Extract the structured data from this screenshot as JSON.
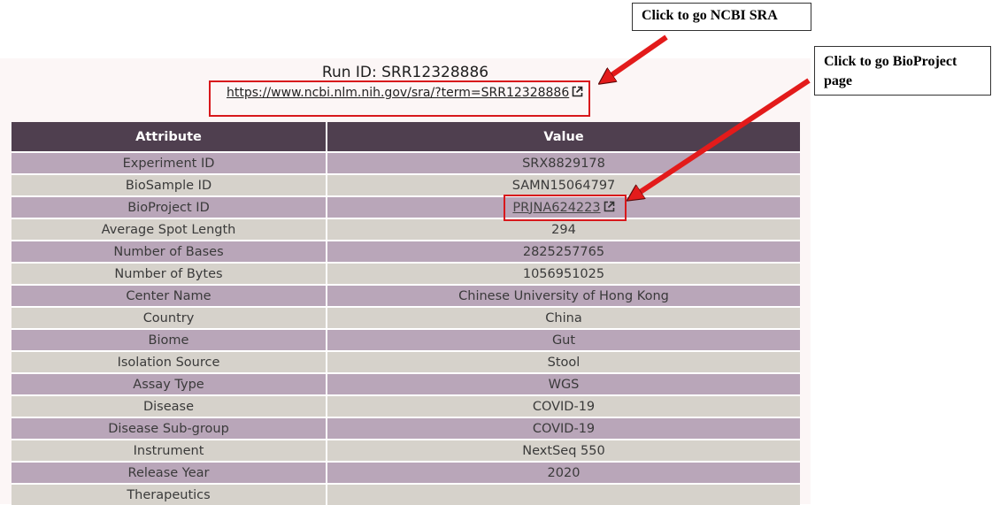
{
  "run_title": "Run ID: SRR12328886",
  "sra_link": "https://www.ncbi.nlm.nih.gov/sra/?term=SRR12328886",
  "table": {
    "headers": [
      "Attribute",
      "Value"
    ],
    "rows": [
      {
        "attribute": "Experiment ID",
        "value": "SRX8829178"
      },
      {
        "attribute": "BioSample ID",
        "value": "SAMN15064797"
      },
      {
        "attribute": "BioProject ID",
        "value": "PRJNA624223",
        "link": true
      },
      {
        "attribute": "Average Spot Length",
        "value": "294"
      },
      {
        "attribute": "Number of Bases",
        "value": "2825257765"
      },
      {
        "attribute": "Number of Bytes",
        "value": "1056951025"
      },
      {
        "attribute": "Center Name",
        "value": "Chinese University of Hong Kong"
      },
      {
        "attribute": "Country",
        "value": "China"
      },
      {
        "attribute": "Biome",
        "value": "Gut"
      },
      {
        "attribute": "Isolation Source",
        "value": "Stool"
      },
      {
        "attribute": "Assay Type",
        "value": "WGS"
      },
      {
        "attribute": "Disease",
        "value": "COVID-19"
      },
      {
        "attribute": "Disease Sub-group",
        "value": "COVID-19"
      },
      {
        "attribute": "Instrument",
        "value": "NextSeq 550"
      },
      {
        "attribute": "Release Year",
        "value": "2020"
      },
      {
        "attribute": "Therapeutics",
        "value": ""
      }
    ]
  },
  "callouts": {
    "sra": "Click to go NCBI SRA",
    "bioproject": "Click to go BioProject page"
  },
  "colors": {
    "header_bg": "#4f3f4f",
    "row_odd": "#b9a6b9",
    "row_even": "#d6d2cb",
    "highlight": "#d8181c"
  }
}
